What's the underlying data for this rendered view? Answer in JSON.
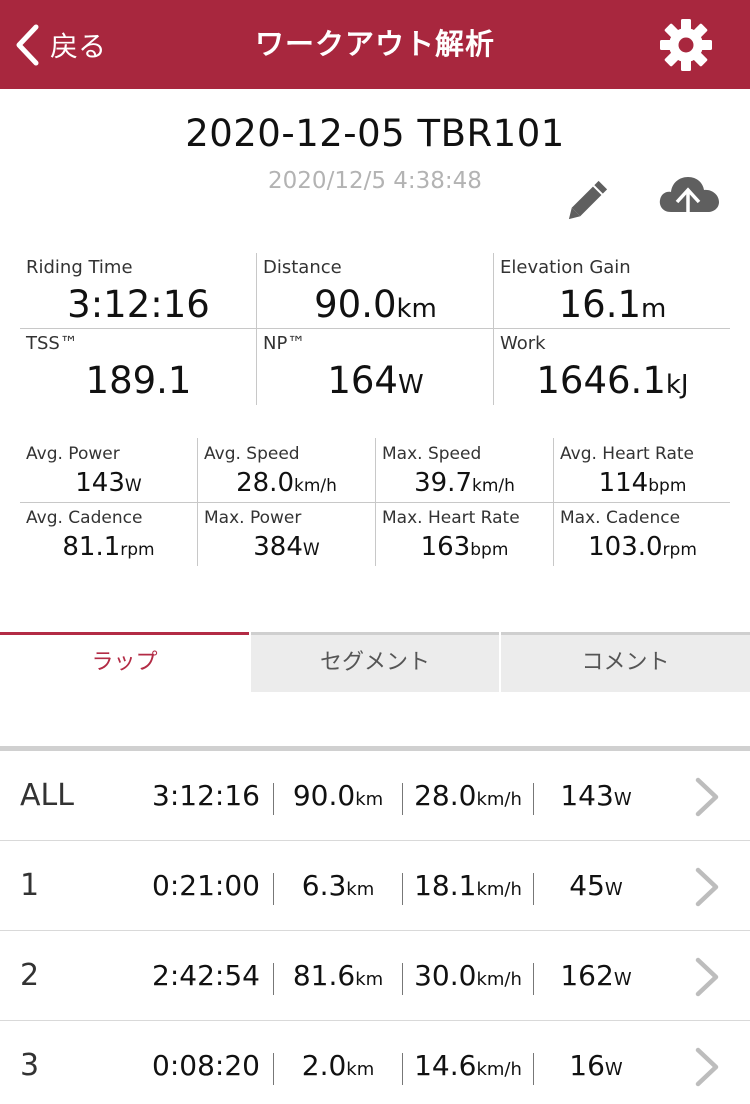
{
  "header": {
    "back_label": "戻る",
    "title": "ワークアウト解析",
    "back_icon": "chevron-left-icon",
    "settings_icon": "gear-icon",
    "bar_color": "#a8273e"
  },
  "workout": {
    "title": "2020-12-05 TBR101",
    "datetime": "2020/12/5 4:38:48",
    "edit_icon": "pencil-icon",
    "upload_icon": "cloud-upload-icon"
  },
  "main_stats": [
    {
      "label": "Riding Time",
      "value": "3:12:16",
      "unit": ""
    },
    {
      "label": "Distance",
      "value": "90.0",
      "unit": "km"
    },
    {
      "label": "Elevation Gain",
      "value": "16.1",
      "unit": "m"
    },
    {
      "label": "TSS™",
      "value": "189.1",
      "unit": ""
    },
    {
      "label": "NP™",
      "value": "164",
      "unit": "W"
    },
    {
      "label": "Work",
      "value": "1646.1",
      "unit": "kJ"
    }
  ],
  "sub_stats": [
    {
      "label": "Avg. Power",
      "value": "143",
      "unit": "W"
    },
    {
      "label": "Avg. Speed",
      "value": "28.0",
      "unit": "km/h"
    },
    {
      "label": "Max. Speed",
      "value": "39.7",
      "unit": "km/h"
    },
    {
      "label": "Avg. Heart Rate",
      "value": "114",
      "unit": "bpm"
    },
    {
      "label": "Avg. Cadence",
      "value": "81.1",
      "unit": "rpm"
    },
    {
      "label": "Max. Power",
      "value": "384",
      "unit": "W"
    },
    {
      "label": "Max. Heart Rate",
      "value": "163",
      "unit": "bpm"
    },
    {
      "label": "Max. Cadence",
      "value": "103.0",
      "unit": "rpm"
    }
  ],
  "tabs": [
    {
      "label": "ラップ",
      "active": true
    },
    {
      "label": "セグメント",
      "active": false
    },
    {
      "label": "コメント",
      "active": false
    }
  ],
  "laps": [
    {
      "name": "ALL",
      "time": "3:12:16",
      "distance": "90.0",
      "distance_unit": "km",
      "speed": "28.0",
      "speed_unit": "km/h",
      "power": "143",
      "power_unit": "W"
    },
    {
      "name": "1",
      "time": "0:21:00",
      "distance": "6.3",
      "distance_unit": "km",
      "speed": "18.1",
      "speed_unit": "km/h",
      "power": "45",
      "power_unit": "W"
    },
    {
      "name": "2",
      "time": "2:42:54",
      "distance": "81.6",
      "distance_unit": "km",
      "speed": "30.0",
      "speed_unit": "km/h",
      "power": "162",
      "power_unit": "W"
    },
    {
      "name": "3",
      "time": "0:08:20",
      "distance": "2.0",
      "distance_unit": "km",
      "speed": "14.6",
      "speed_unit": "km/h",
      "power": "16",
      "power_unit": "W"
    }
  ]
}
